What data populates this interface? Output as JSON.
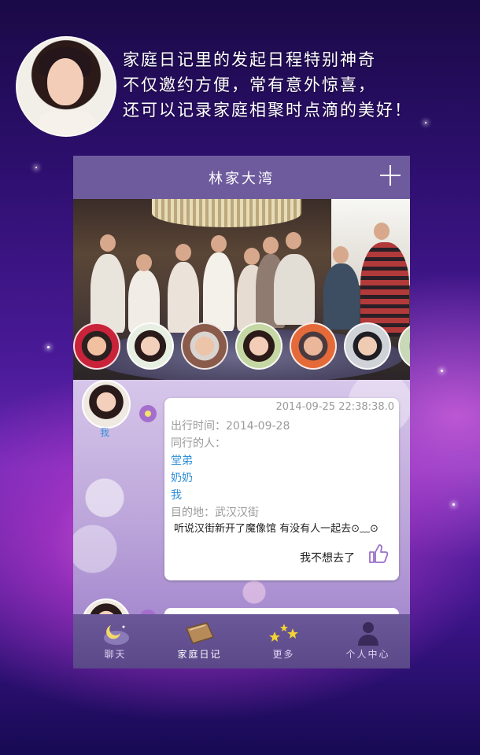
{
  "intro": {
    "lines": [
      "家庭日记里的发起日程特别神奇",
      "不仅邀约方便，常有意外惊喜，",
      "还可以记录家庭相聚时点滴的美好！"
    ]
  },
  "header": {
    "title": "林家大湾",
    "add_icon": "plus-icon"
  },
  "post": {
    "author_label": "我",
    "timestamp": "2014-09-25 22:38:38.0",
    "depart_line": "出行时间：2014-09-28",
    "companions_label": "同行的人：",
    "companions": [
      "堂弟",
      "奶奶",
      "我"
    ],
    "destination_line": "目的地：武汉汉街",
    "description": "听说汉街新开了魔像馆 有没有人一起去⊙﹏⊙",
    "reply_text": "我不想去了",
    "reply_icon": "thumbs-up-icon"
  },
  "tabs": [
    {
      "label": "聊天",
      "icon": "moon-chat-icon"
    },
    {
      "label": "家庭日记",
      "icon": "diary-book-icon",
      "active": true
    },
    {
      "label": "更多",
      "icon": "stars-icon"
    },
    {
      "label": "个人中心",
      "icon": "person-icon"
    }
  ],
  "colors": {
    "header_bg": "#6e5b9d",
    "tabbar_bg": "#5a4888",
    "link_blue": "#2f8fd8",
    "accent_purple": "#a46fcc"
  }
}
